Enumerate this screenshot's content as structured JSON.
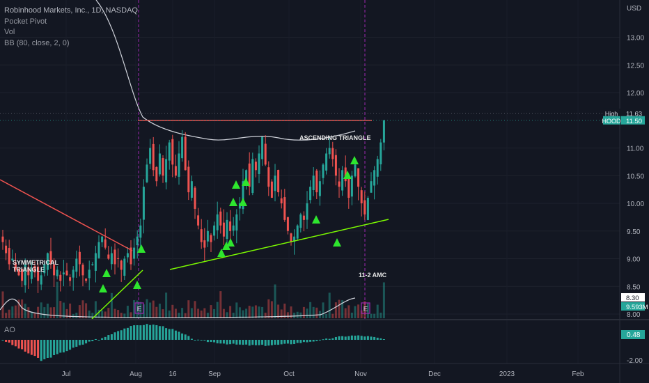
{
  "chart_data": {
    "type": "candlestick",
    "header": {
      "symbol_line": "Robinhood Markets, Inc., 1D, NASDAQ",
      "indicators": [
        "Pocket Pivot",
        "Vol",
        "BB (80, close, 2, 0)"
      ]
    },
    "price_axis": {
      "currency": "USD",
      "ticks": [
        "13.00",
        "12.50",
        "12.00",
        "11.00",
        "10.50",
        "10.00",
        "9.50",
        "9.00",
        "8.50",
        "8.00"
      ],
      "ylim": [
        8.0,
        13.5
      ]
    },
    "time_axis": {
      "labels": [
        "Jul",
        "Aug",
        "16",
        "Sep",
        "Oct",
        "Nov",
        "Dec",
        "2023",
        "Feb"
      ]
    },
    "badges": [
      {
        "label": "High",
        "value": "11.63",
        "color": "#131722"
      },
      {
        "label": "HOOD",
        "value": "11.50",
        "color": "#26a69a"
      },
      {
        "label": "",
        "value": "8.30",
        "color": "#ffffff"
      },
      {
        "label": "",
        "value": "9.593M",
        "color": "#26a69a"
      }
    ],
    "annotations": {
      "symmetrical": "SYMMETRICAL\nTRIANGLE",
      "ascending": "ASCENDING TRIANGLE",
      "earnings_note": "11-2 AMC",
      "earnings_marker": "E"
    },
    "resistance_level": 11.5,
    "ao": {
      "label": "AO",
      "ticks": [
        "0.48",
        "-2.00"
      ],
      "last_value": "0.48"
    },
    "colors": {
      "up": "#26a69a",
      "down": "#ef5350",
      "bb": "#d1d4dc",
      "trend_red": "#f05350",
      "trend_green": "#7cfc00",
      "pocket_pivot": "#2ee62e",
      "earnings": "#9c27b0"
    }
  }
}
